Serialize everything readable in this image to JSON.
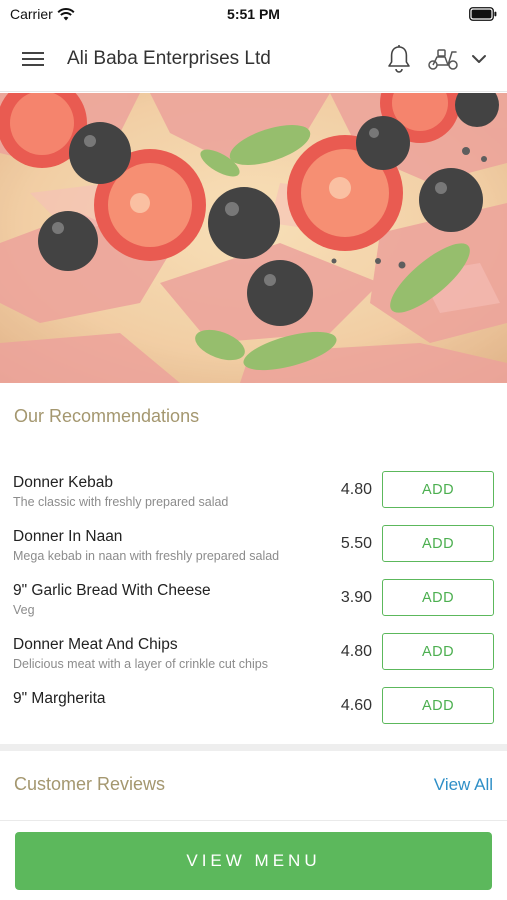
{
  "status_bar": {
    "carrier": "Carrier",
    "time": "5:51 PM"
  },
  "header": {
    "title": "Ali Baba Enterprises Ltd"
  },
  "recommendations": {
    "title": "Our Recommendations",
    "items": [
      {
        "name": "Donner Kebab",
        "description": "The classic with freshly prepared salad",
        "price": "4.80",
        "action": "ADD"
      },
      {
        "name": "Donner In Naan",
        "description": "Mega kebab in naan with freshly prepared salad",
        "price": "5.50",
        "action": "ADD"
      },
      {
        "name": "9\" Garlic Bread With Cheese",
        "description": "Veg",
        "price": "3.90",
        "action": "ADD"
      },
      {
        "name": "Donner Meat And Chips",
        "description": "Delicious meat with a layer of crinkle cut chips",
        "price": "4.80",
        "action": "ADD"
      },
      {
        "name": "9\" Margherita",
        "description": "",
        "price": "4.60",
        "action": "ADD"
      }
    ]
  },
  "reviews": {
    "title": "Customer Reviews",
    "view_all": "View All"
  },
  "footer": {
    "view_menu": "VIEW MENU"
  },
  "colors": {
    "accent_green": "#5cb85c",
    "section_title": "#a4976f",
    "link_blue": "#2f8fc7"
  },
  "icons": [
    "wifi-icon",
    "battery-icon",
    "hamburger-menu-icon",
    "bell-icon",
    "scooter-icon",
    "chevron-down-icon"
  ]
}
